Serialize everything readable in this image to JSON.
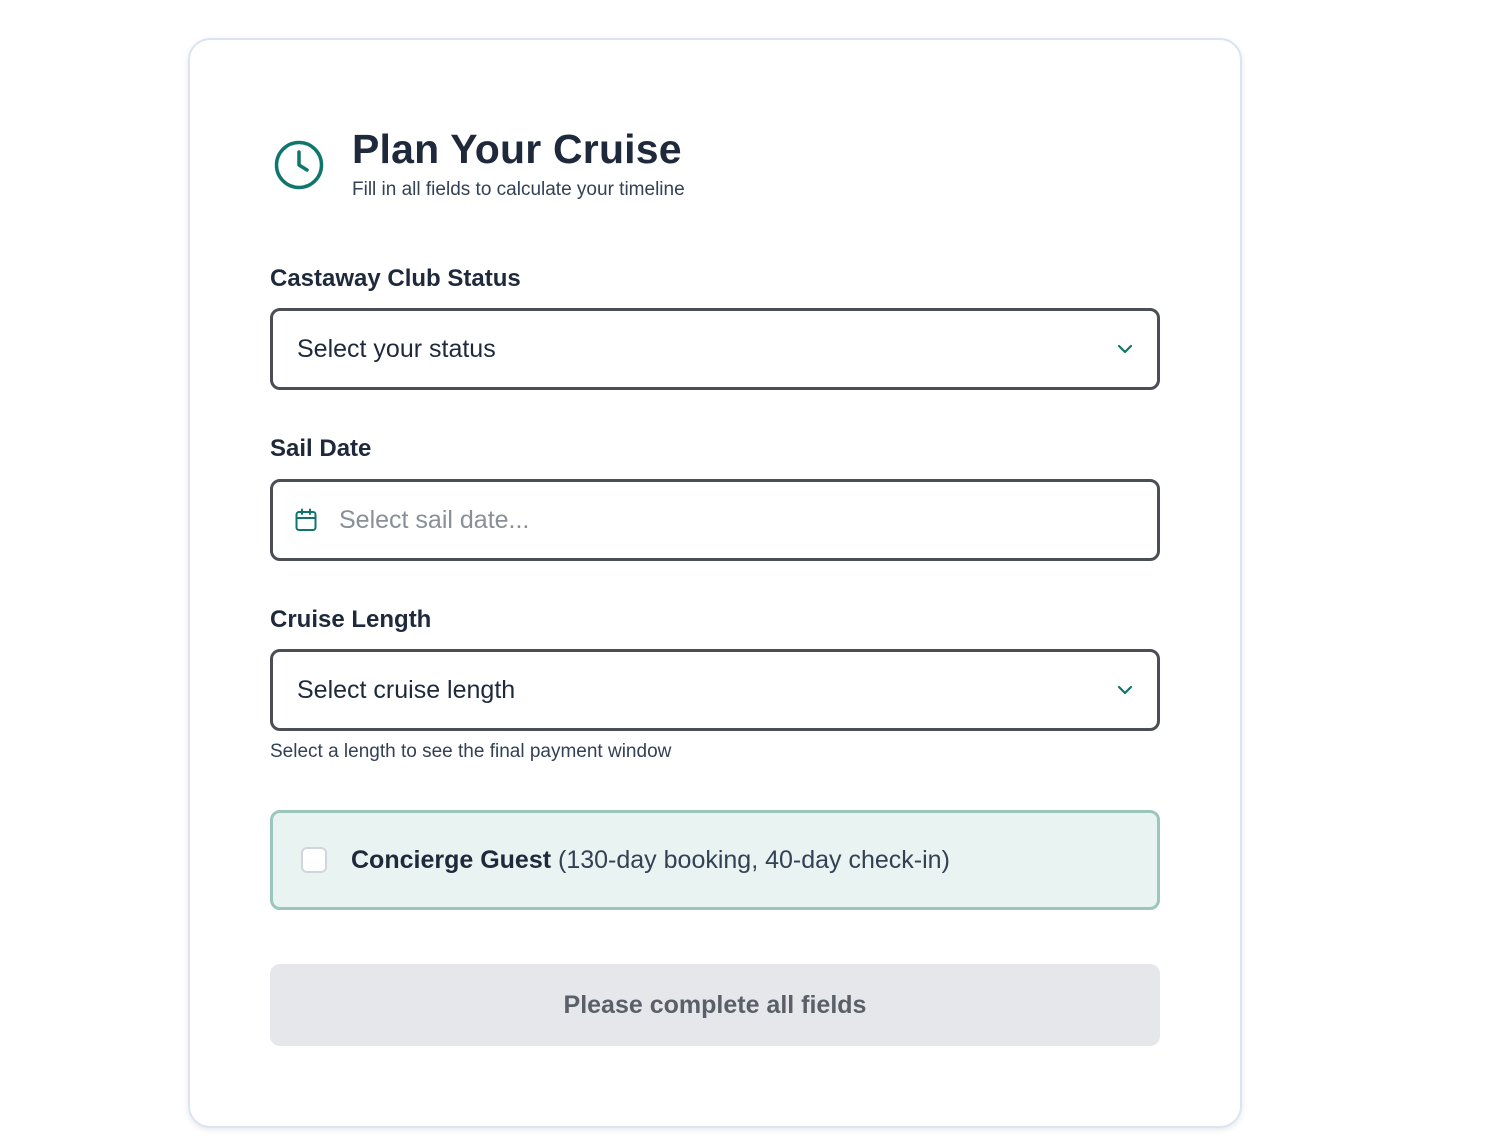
{
  "header": {
    "title": "Plan Your Cruise",
    "subtitle": "Fill in all fields to calculate your timeline",
    "icon": "clock-icon"
  },
  "status_field": {
    "label": "Castaway Club Status",
    "value": "Select your status",
    "icon": "chevron-down-icon"
  },
  "sail_date_field": {
    "label": "Sail Date",
    "placeholder": "Select sail date...",
    "icon": "calendar-icon"
  },
  "length_field": {
    "label": "Cruise Length",
    "value": "Select cruise length",
    "helper": "Select a length to see the final payment window",
    "icon": "chevron-down-icon"
  },
  "concierge": {
    "label": "Concierge Guest",
    "detail": "(130-day booking, 40-day check-in)",
    "checked": false
  },
  "submit": {
    "label": "Please complete all fields"
  },
  "colors": {
    "accent": "#0f766e",
    "concierge_bg": "#e9f3f1",
    "concierge_border": "#9cc5bd",
    "button_disabled_bg": "#e5e7eb"
  }
}
